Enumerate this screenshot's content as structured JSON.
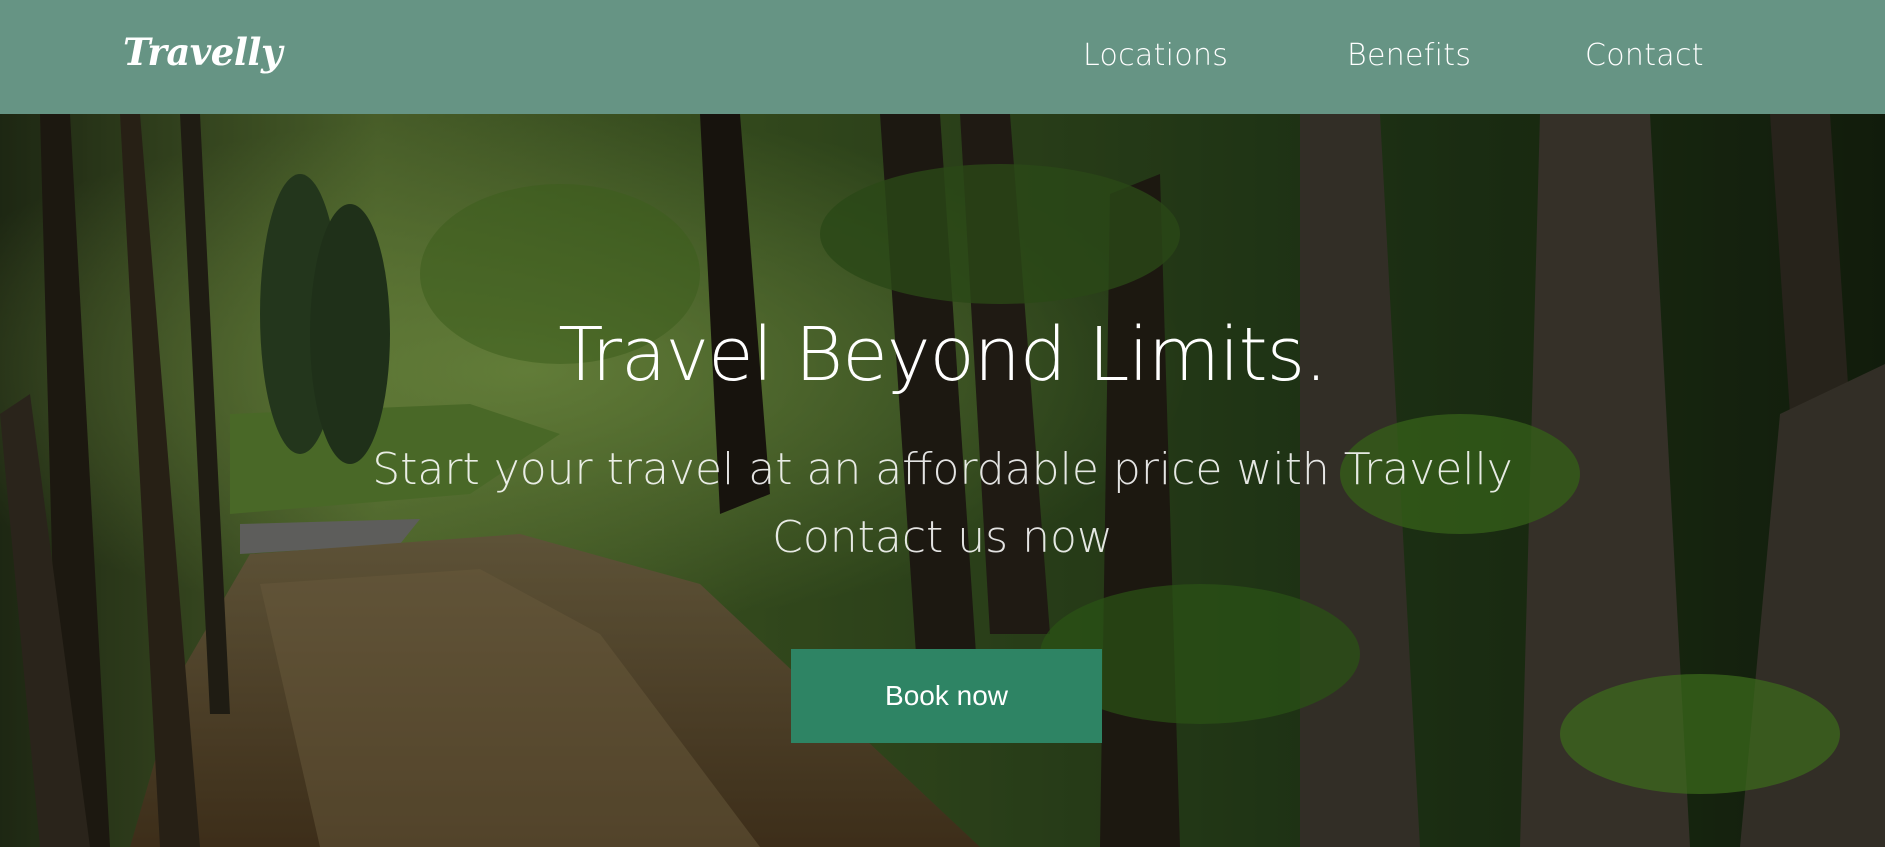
{
  "header": {
    "logo": "Travelly",
    "nav": {
      "locations": "Locations",
      "benefits": "Benefits",
      "contact": "Contact"
    }
  },
  "hero": {
    "title": "Travel Beyond Limits.",
    "subtitle_line1": "Start your travel at an affordable price with Travelly",
    "subtitle_line2": "Contact us now",
    "cta_label": "Book now"
  },
  "colors": {
    "navbar": "#669484",
    "cta": "#2e8464",
    "text": "#ffffff"
  }
}
